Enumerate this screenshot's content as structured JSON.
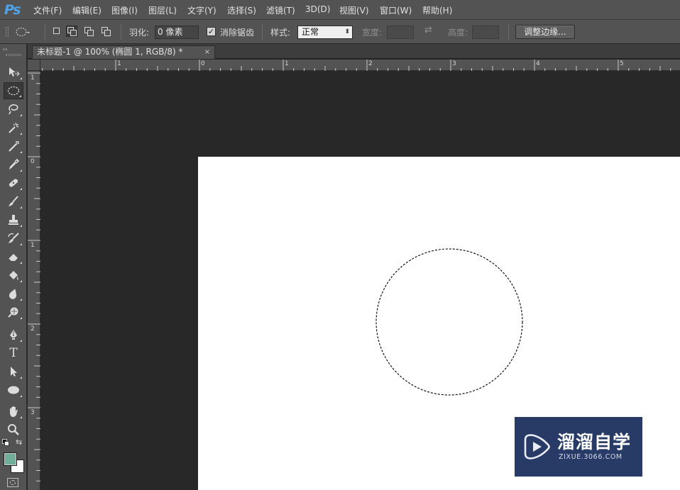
{
  "app": {
    "logo": "Ps"
  },
  "menu": [
    "文件(F)",
    "编辑(E)",
    "图像(I)",
    "图层(L)",
    "文字(Y)",
    "选择(S)",
    "滤镜(T)",
    "3D(D)",
    "视图(V)",
    "窗口(W)",
    "帮助(H)"
  ],
  "options": {
    "feather_label": "羽化:",
    "feather_value": "0 像素",
    "antialias_label": "消除锯齿",
    "antialias_checked": true,
    "style_label": "样式:",
    "style_value": "正常",
    "width_label": "宽度:",
    "height_label": "高度:",
    "refine_button": "调整边缘..."
  },
  "document": {
    "tab_title": "未标题-1 @ 100% (椭圆 1, RGB/8) *",
    "close_glyph": "×",
    "canvas_color": "#ffffff"
  },
  "rulers": {
    "top_labels": [
      "1",
      "0",
      "1",
      "2",
      "3",
      "4",
      "5"
    ],
    "left_labels": [
      "1",
      "0",
      "1",
      "2",
      "3"
    ]
  },
  "toolbox": {
    "tools": [
      "move-tool",
      "elliptical-marquee-tool",
      "lasso-tool",
      "magic-wand-tool",
      "crop-tool",
      "eyedropper-tool",
      "spot-healing-tool",
      "brush-tool",
      "clone-stamp-tool",
      "history-brush-tool",
      "eraser-tool",
      "paint-bucket-tool",
      "blur-tool",
      "dodge-tool",
      "pen-tool",
      "type-tool",
      "path-selection-tool",
      "ellipse-shape-tool",
      "hand-tool",
      "zoom-tool"
    ],
    "type_tool_glyph": "T",
    "foreground_color": "#6fae98",
    "background_color": "#ffffff",
    "selected_tool": "elliptical-marquee-tool"
  },
  "watermark": {
    "title": "溜溜自学",
    "subtitle": "ZIXUE.3066.COM",
    "bg_color": "#283a66"
  }
}
